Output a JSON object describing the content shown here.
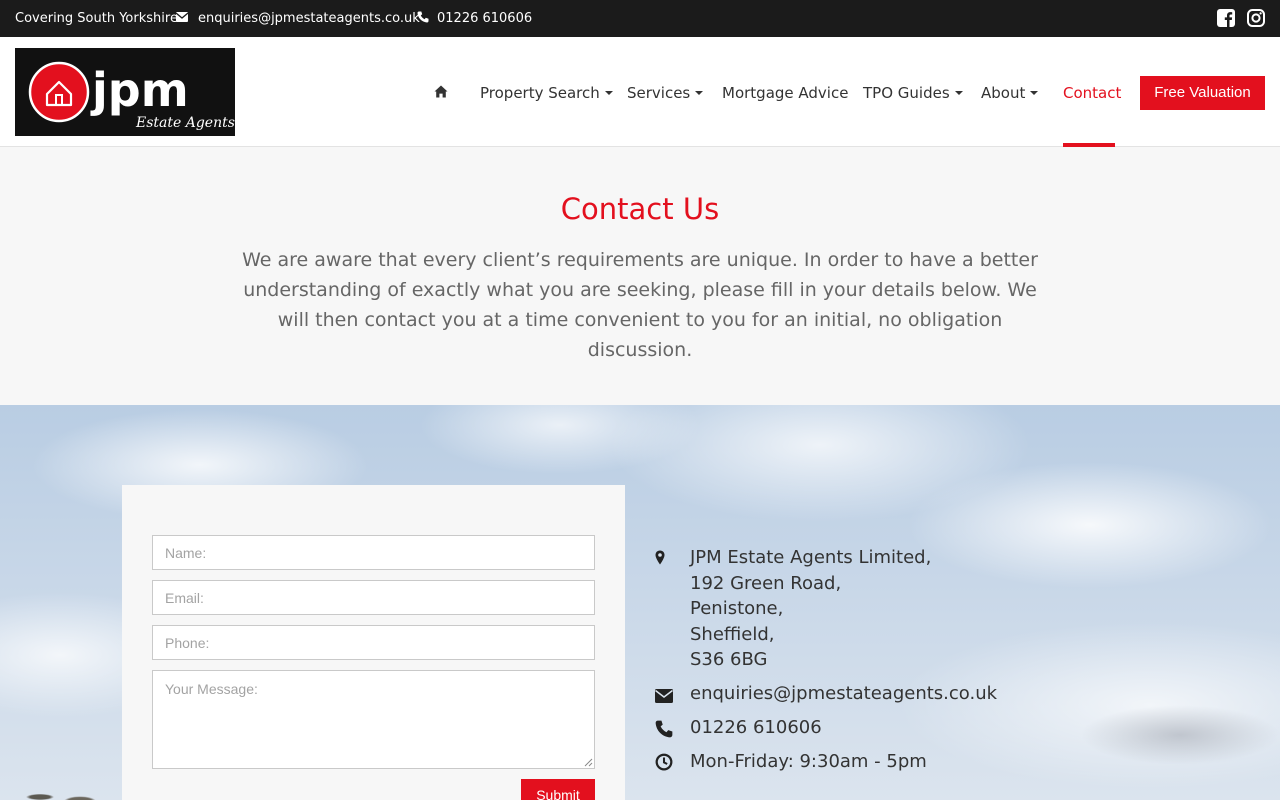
{
  "topbar": {
    "region": "Covering South Yorkshire",
    "email": "enquiries@jpmestateagents.co.uk",
    "phone": "01226 610606",
    "icons": [
      "envelope-icon",
      "phone-icon",
      "facebook-icon",
      "instagram-icon"
    ]
  },
  "logo": {
    "brand": "jpm",
    "tagline": "Estate Agents"
  },
  "nav": {
    "home_icon": "home-icon",
    "items": [
      {
        "label": "Property Search",
        "dropdown": true
      },
      {
        "label": "Services",
        "dropdown": true
      },
      {
        "label": "Mortgage Advice",
        "dropdown": false
      },
      {
        "label": "TPO Guides",
        "dropdown": true
      },
      {
        "label": "About",
        "dropdown": true
      },
      {
        "label": "Contact",
        "dropdown": false,
        "active": true
      }
    ],
    "cta": "Free Valuation"
  },
  "intro": {
    "title": "Contact Us",
    "text": "We are aware that every client’s requirements are unique. In order to have a better understanding of exactly what you are seeking, please fill in your details below. We will then contact you at a time convenient to you for an initial, no obligation discussion."
  },
  "form": {
    "name_placeholder": "Name:",
    "email_placeholder": "Email:",
    "phone_placeholder": "Phone:",
    "message_placeholder": "Your Message:",
    "submit": "Submit"
  },
  "contact_info": {
    "address": [
      "JPM Estate Agents Limited,",
      "192 Green Road,",
      "Penistone,",
      "Sheffield,",
      "S36 6BG"
    ],
    "email": "enquiries@jpmestateagents.co.uk",
    "phone": "01226 610606",
    "hours": "Mon-Friday: 9:30am - 5pm",
    "icons": [
      "map-marker-icon",
      "envelope-icon",
      "phone-icon",
      "clock-icon"
    ]
  },
  "colors": {
    "accent": "#e3101e",
    "topbar": "#1b1b1b",
    "text": "#333333"
  }
}
